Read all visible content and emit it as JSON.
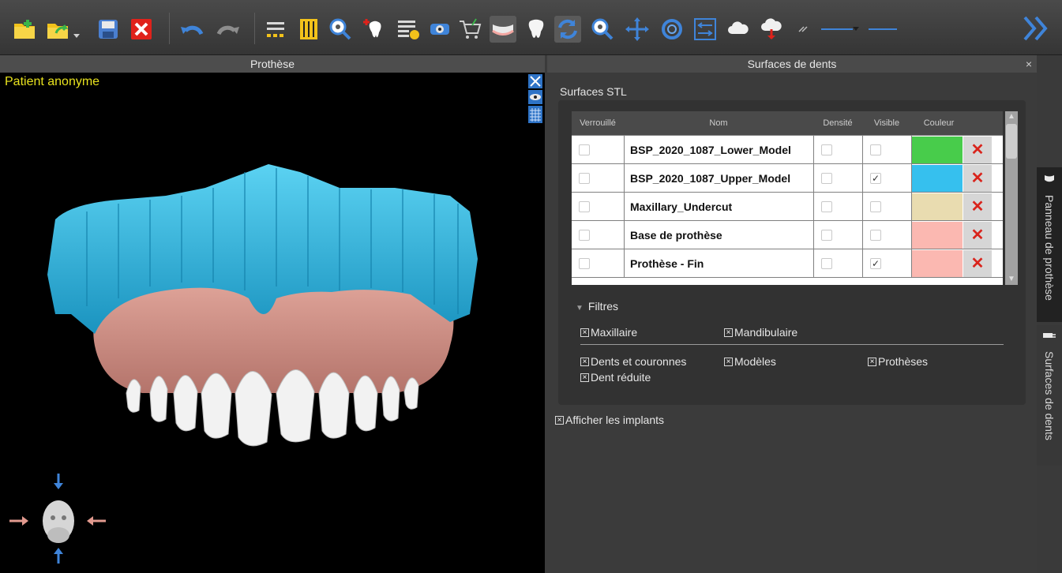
{
  "toolbar": {
    "buttons": [
      "open-folder",
      "open-recent",
      "save",
      "close",
      "undo",
      "redo",
      "align",
      "ruler",
      "zoom",
      "add-tooth",
      "list-settings",
      "view-eye",
      "cart",
      "teeth-arch",
      "tooth",
      "refresh",
      "zoom-2",
      "pan",
      "rotate",
      "measure",
      "cloud-upload",
      "cloud-download",
      "expand-more"
    ]
  },
  "viewport": {
    "title": "Prothèse",
    "patient": "Patient anonyme"
  },
  "panel": {
    "title": "Surfaces de dents",
    "close": "×",
    "section": "Surfaces STL",
    "columns": [
      "Verrouillé",
      "Nom",
      "Densité",
      "Visible",
      "Couleur"
    ],
    "rows": [
      {
        "name": "BSP_2020_1087_Lower_Model",
        "visible": false,
        "color": "#48cc4b"
      },
      {
        "name": "BSP_2020_1087_Upper_Model",
        "visible": true,
        "color": "#36c0ee"
      },
      {
        "name": "Maxillary_Undercut",
        "visible": false,
        "color": "#e9dcb0"
      },
      {
        "name": "Base de prothèse",
        "visible": false,
        "color": "#fbb8b1"
      },
      {
        "name": "Prothèse - Fin",
        "visible": true,
        "color": "#fbb8b1"
      }
    ],
    "filters": {
      "label": "Filtres",
      "items": [
        "Maxillaire",
        "Mandibulaire",
        "Dents et couronnes",
        "Modèles",
        "Prothèses",
        "Dent réduite"
      ]
    },
    "show_implants": "Afficher les implants"
  },
  "sidetabs": [
    "Panneau de prothèse",
    "Surfaces de dents"
  ],
  "colors": {
    "accent_yellow": "#e8e21e",
    "tooth_blue": "#36c0ee",
    "gum_pink": "#d7958a"
  }
}
